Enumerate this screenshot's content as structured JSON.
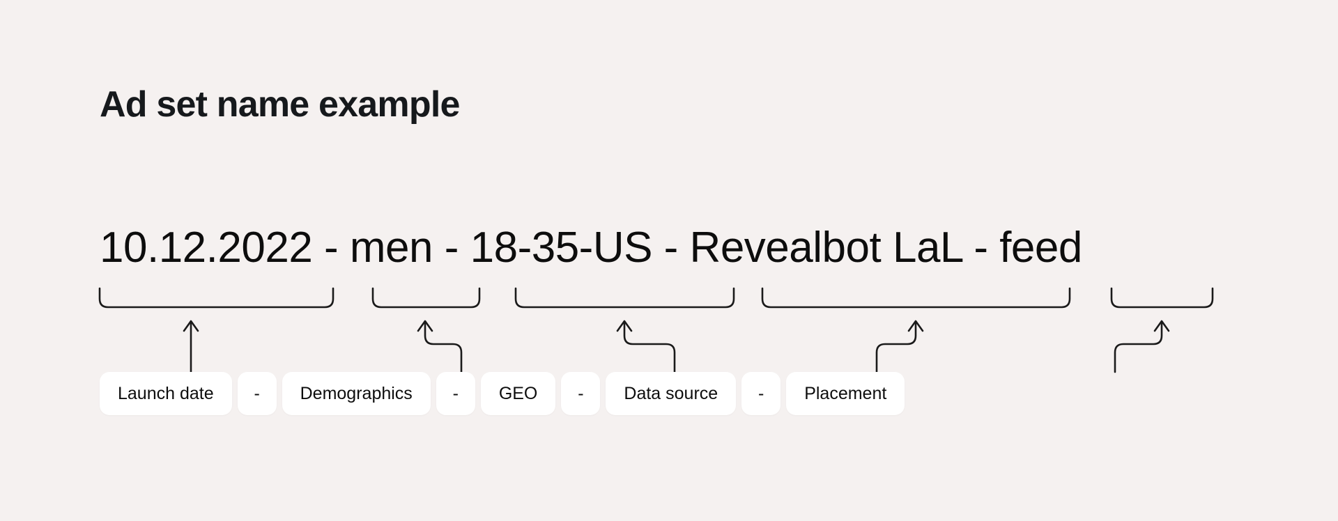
{
  "page": {
    "background_color": "#F5F1F0",
    "title": "Ad set name example"
  },
  "example": {
    "full_name": "10.12.2022 - men - 18-35-US - Revealbot LaL - feed",
    "segments": [
      {
        "value": "10.12.2022",
        "label": "Launch date"
      },
      {
        "value": "men",
        "label": "Demographics"
      },
      {
        "value": "18-35-US",
        "label": "GEO"
      },
      {
        "value": "Revealbot LaL",
        "label": "Data source"
      },
      {
        "value": "feed",
        "label": "Placement"
      }
    ],
    "separator": "-"
  },
  "legend": {
    "items": [
      {
        "type": "label",
        "text": "Launch date"
      },
      {
        "type": "separator",
        "text": "-"
      },
      {
        "type": "label",
        "text": "Demographics"
      },
      {
        "type": "separator",
        "text": "-"
      },
      {
        "type": "label",
        "text": "GEO"
      },
      {
        "type": "separator",
        "text": "-"
      },
      {
        "type": "label",
        "text": "Data source"
      },
      {
        "type": "separator",
        "text": "-"
      },
      {
        "type": "label",
        "text": "Placement"
      }
    ]
  },
  "colors": {
    "text": "#0D0D0D",
    "title": "#16191C",
    "pill_background": "#FFFFFF",
    "connector_stroke": "#1A1A1A"
  }
}
